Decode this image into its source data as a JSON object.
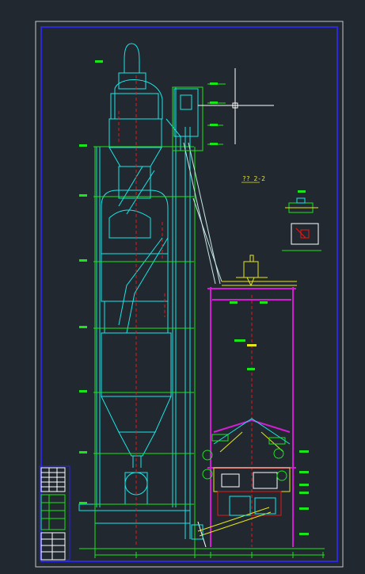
{
  "view": {
    "background": "#212830",
    "cursor_crosshair": "crosshair-cursor"
  },
  "colors": {
    "sheet_border": "#c8c8c8",
    "frame": "#2a2ad8",
    "cyan": "#19e6e6",
    "green": "#19e619",
    "red": "#e61919",
    "yellow": "#e6e619",
    "magenta": "#d21ed2",
    "white": "#ffffff"
  },
  "drawing": {
    "section_title": "?? 2-2"
  }
}
